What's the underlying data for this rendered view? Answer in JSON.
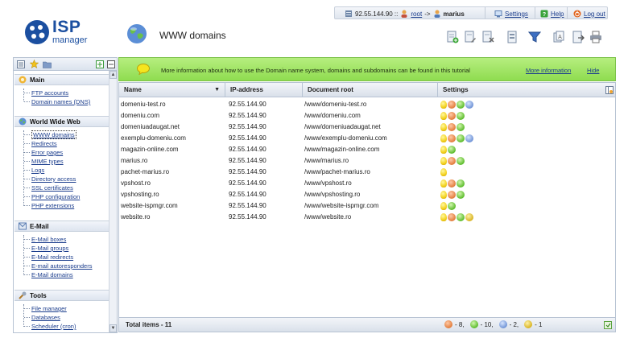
{
  "header": {
    "logo_isp": "ISP",
    "logo_manager": "manager",
    "page_title": "WWW domains",
    "ip": "92.55.144.90 ::",
    "user_from": "root",
    "arrow": "->",
    "user_to": "marius",
    "settings": "Settings",
    "help": "Help",
    "logout": "Log out"
  },
  "banner": {
    "text": "More information about how to use the Domain name system, domains and subdomains can be found in this tutorial",
    "more": "More information",
    "hide": "Hide"
  },
  "sidebar": {
    "groups": [
      {
        "title": "Main",
        "items": [
          "FTP accounts",
          "Domain names (DNS)"
        ]
      },
      {
        "title": "World Wide Web",
        "items": [
          "WWW domains",
          "Redirects",
          "Error pages",
          "MIME types",
          "Logs",
          "Directory access",
          "SSL certificates",
          "PHP configuration",
          "PHP extensions"
        ]
      },
      {
        "title": "E-Mail",
        "items": [
          "E-Mail boxes",
          "E-Mail groups",
          "E-Mail redirects",
          "E-mail autoresponders",
          "E-Mail domains"
        ]
      },
      {
        "title": "Tools",
        "items": [
          "File manager",
          "Databases",
          "Scheduler (cron)"
        ]
      }
    ]
  },
  "table": {
    "columns": [
      "Name",
      "IP-address",
      "Document root",
      "Settings"
    ],
    "rows": [
      {
        "name": "domeniu-test.ro",
        "ip": "92.55.144.90",
        "root": "/www/domeniu-test.ro",
        "icons": [
          "bulb",
          "php",
          "cgi",
          "ssl"
        ]
      },
      {
        "name": "domeniu.com",
        "ip": "92.55.144.90",
        "root": "/www/domeniu.com",
        "icons": [
          "bulb",
          "php",
          "cgi"
        ]
      },
      {
        "name": "domeniuadaugat.net",
        "ip": "92.55.144.90",
        "root": "/www/domeniuadaugat.net",
        "icons": [
          "bulb",
          "php",
          "cgi"
        ]
      },
      {
        "name": "exemplu-domeniu.com",
        "ip": "92.55.144.90",
        "root": "/www/exemplu-domeniu.com",
        "icons": [
          "bulb",
          "php",
          "cgi",
          "ssl"
        ]
      },
      {
        "name": "magazin-online.com",
        "ip": "92.55.144.90",
        "root": "/www/magazin-online.com",
        "icons": [
          "bulb",
          "cgi"
        ]
      },
      {
        "name": "marius.ro",
        "ip": "92.55.144.90",
        "root": "/www/marius.ro",
        "icons": [
          "bulb",
          "php",
          "cgi"
        ]
      },
      {
        "name": "pachet-marius.ro",
        "ip": "92.55.144.90",
        "root": "/www/pachet-marius.ro",
        "icons": [
          "bulb"
        ]
      },
      {
        "name": "vpshost.ro",
        "ip": "92.55.144.90",
        "root": "/www/vpshost.ro",
        "icons": [
          "bulb",
          "php",
          "cgi"
        ]
      },
      {
        "name": "vpshosting.ro",
        "ip": "92.55.144.90",
        "root": "/www/vpshosting.ro",
        "icons": [
          "bulb",
          "php",
          "cgi"
        ]
      },
      {
        "name": "website-ispmgr.com",
        "ip": "92.55.144.90",
        "root": "/www/website-ispmgr.com",
        "icons": [
          "bulb",
          "cgi"
        ]
      },
      {
        "name": "website.ro",
        "ip": "92.55.144.90",
        "root": "/www/website.ro",
        "icons": [
          "bulb",
          "php",
          "cgi",
          "ssi"
        ]
      }
    ],
    "total": "Total items - 11",
    "stats": [
      {
        "icon": "php",
        "text": "- 8,"
      },
      {
        "icon": "cgi",
        "text": "- 10,"
      },
      {
        "icon": "ssl",
        "text": "- 2,"
      },
      {
        "icon": "ssi",
        "text": "- 1"
      }
    ]
  }
}
